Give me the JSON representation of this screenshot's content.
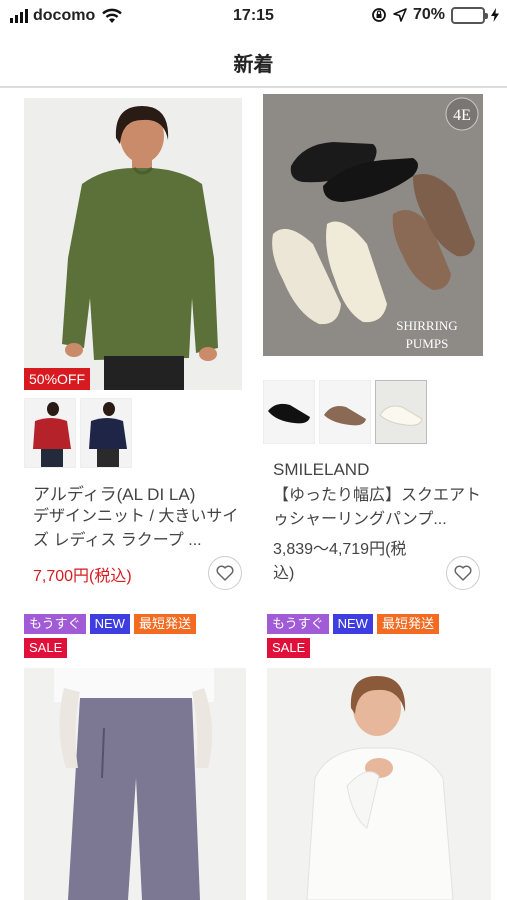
{
  "status": {
    "carrier": "docomo",
    "time": "17:15",
    "battery_percent": "70%",
    "battery_level": 0.7
  },
  "header": {
    "title": "新着"
  },
  "products": [
    {
      "off_badge": "50%OFF",
      "brand": "アルディラ(AL DI LA)",
      "name": "デザインニット / 大きいサイズ レディス ラクープ ...",
      "price": "7,700円(税込)",
      "price_color": "#d71920"
    },
    {
      "photo_badge": "4E",
      "photo_caption_1": "SHIRRING",
      "photo_caption_2": "PUMPS",
      "brand": "SMILELAND",
      "name": "【ゆったり幅広】スクエアトゥシャーリングパンプ...",
      "price_line1": "3,839〜4,719円(税",
      "price_line2": "込)"
    }
  ],
  "tags": {
    "soon": "もうすぐ",
    "new": "NEW",
    "fast": "最短発送",
    "sale": "SALE"
  }
}
